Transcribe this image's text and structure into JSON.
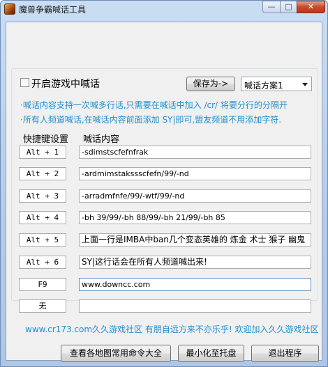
{
  "window": {
    "title": "魔兽争霸喊话工具",
    "controls": {
      "minimize": "—",
      "maximize": "□",
      "close": "✕"
    }
  },
  "options": {
    "enable_shout_label": "开启游戏中喊话",
    "enable_shout_checked": false,
    "save_as_label": "保存为->",
    "scheme_selected": "喊话方案1"
  },
  "hints": [
    "·喊话内容支持一次喊多行话,只需要在喊话中加入 /cr/ 将要分行的分隔开",
    "·所有人频道喊话,在喊话内容前面添加 SY|即可,盟友频道不用添加字符."
  ],
  "columns": {
    "hotkey": "快捷键设置",
    "content": "喊话内容"
  },
  "rows": [
    {
      "hotkey": "Alt + 1",
      "content": "-sdimstscfefnfrak"
    },
    {
      "hotkey": "Alt + 2",
      "content": "-ardmimstakssscfefn/99/-nd"
    },
    {
      "hotkey": "Alt + 3",
      "content": "-arradmfnfe/99/-wtf/99/-nd"
    },
    {
      "hotkey": "Alt + 4",
      "content": "-bh 39/99/-bh 88/99/-bh 21/99/-bh 85"
    },
    {
      "hotkey": "Alt + 5",
      "content": "上面一行是IMBA中ban几个变态英雄的 炼金 术士 猴子 幽鬼"
    },
    {
      "hotkey": "Alt + 6",
      "content": "SY|这行话会在所有人频道喊出来!"
    },
    {
      "hotkey": "F9",
      "content": "www.downcc.com"
    },
    {
      "hotkey": "无",
      "content": ""
    }
  ],
  "footer_text": "www.cr173.com久久游戏社区 有朋自远方来不亦乐乎! 欢迎加入久久游戏社区",
  "buttons": {
    "map_commands": "查看各地图常用命令大全",
    "minimize_tray": "最小化至托盘",
    "exit": "退出程序"
  }
}
